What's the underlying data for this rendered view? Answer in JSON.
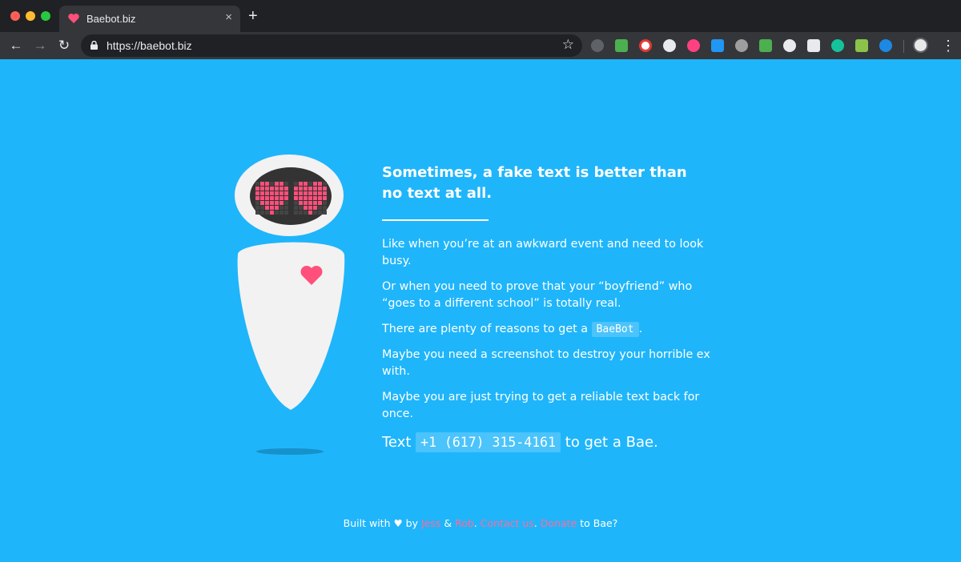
{
  "browser": {
    "tab_title": "Baebot.biz",
    "tab_close": "×",
    "new_tab": "+",
    "url": "https://baebot.biz",
    "back": "←",
    "forward": "→",
    "reload": "↻",
    "bookmark": "☆",
    "menu": "⋮",
    "extensions": [
      "info-icon",
      "chart-icon",
      "adblock-icon",
      "wordpress-icon",
      "color-wheel-icon",
      "photo-icon",
      "ublock-icon",
      "checkmark-icon",
      "circle-icon",
      "cursor-icon",
      "grammarly-icon",
      "image-icon",
      "globe-icon"
    ],
    "extension_colors": [
      "#5f6368",
      "#4caf50",
      "#ffffff",
      "#e8eaed",
      "#ff4081",
      "#2196f3",
      "#9e9e9e",
      "#4caf50",
      "#e8eaed",
      "#e8eaed",
      "#15c39a",
      "#8bc34a",
      "#1e88e5"
    ]
  },
  "hero": {
    "headline_line1": "Sometimes, a fake text is better than",
    "headline_line2": "no text at all.",
    "p1": "Like when you’re at an awkward event and need to look busy.",
    "p2": "Or when you need to prove that your “boyfriend” who “goes to a different school” is totally real.",
    "p3_before": "There are plenty of reasons to get a",
    "p3_code": "BaeBot",
    "p3_after": ".",
    "p4": "Maybe you need a screenshot to destroy your horrible ex with.",
    "p5": "Maybe you are just trying to get a reliable text back for once.",
    "cta_before": "Text",
    "cta_phone": "+1 (617) 315-4161",
    "cta_after": "to get a Bae."
  },
  "footer": {
    "built_with": "Built with ♥ by",
    "jess": "Jess",
    "amp": "&",
    "rob": "Rob",
    "period1": ".",
    "contact": "Contact us",
    "period2": ".",
    "donate": "Donate",
    "to_bae": "to Bae?"
  },
  "colors": {
    "background": "#1fb5fb",
    "accent_pink": "#ff4f7b",
    "robot_body": "#f2f2f2"
  }
}
